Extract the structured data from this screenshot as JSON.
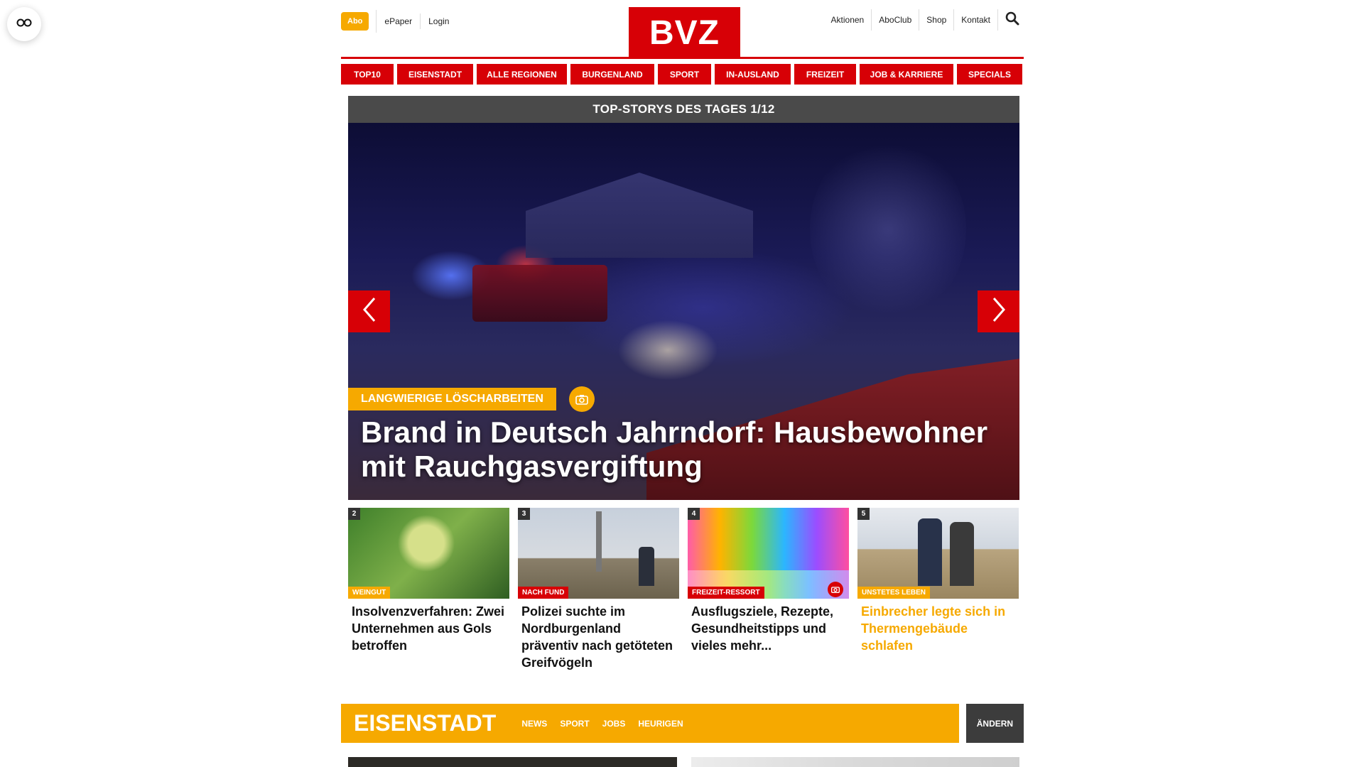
{
  "floating": {
    "icon": "glasses-icon"
  },
  "header": {
    "abo_label": "Abo",
    "left_links": [
      "ePaper",
      "Login"
    ],
    "logo_text": "BVZ",
    "right_links": [
      "Aktionen",
      "AboClub",
      "Shop",
      "Kontakt"
    ],
    "search_icon": "search-icon"
  },
  "nav": {
    "items": [
      "TOP10",
      "EISENSTADT",
      "ALLE REGIONEN",
      "BURGENLAND",
      "SPORT",
      "IN-AUSLAND",
      "FREIZEIT",
      "JOB & KARRIERE",
      "SPECIALS"
    ]
  },
  "hero": {
    "heading": "TOP-STORYS DES TAGES 1/12",
    "kicker": "LANGWIERIGE LÖSCHARBEITEN",
    "title": "Brand in Deutsch Jahrndorf: Hausbewohner mit Rauchgasvergiftung",
    "accent": "#d70006",
    "kicker_color": "#f6a900"
  },
  "teasers": [
    {
      "num": "2",
      "kicker": "WEINGUT",
      "title": "Insolvenzverfahren: Zwei Unternehmen aus Gols betroffen"
    },
    {
      "num": "3",
      "kicker": "NACH FUND",
      "title": "Polizei suchte im Nordburgenland präventiv nach getöteten Greifvögeln"
    },
    {
      "num": "4",
      "kicker": "FREIZEIT-RESSORT",
      "title": "Ausflugsziele, Rezepte, Gesundheitstipps und vieles mehr..."
    },
    {
      "num": "5",
      "kicker": "UNSTETES LEBEN",
      "title": "Einbrecher legte sich in Thermengebäude schlafen"
    }
  ],
  "region": {
    "name": "EISENSTADT",
    "links": [
      "NEWS",
      "SPORT",
      "JOBS",
      "HEURIGEN"
    ],
    "change_label": "ÄNDERN"
  }
}
